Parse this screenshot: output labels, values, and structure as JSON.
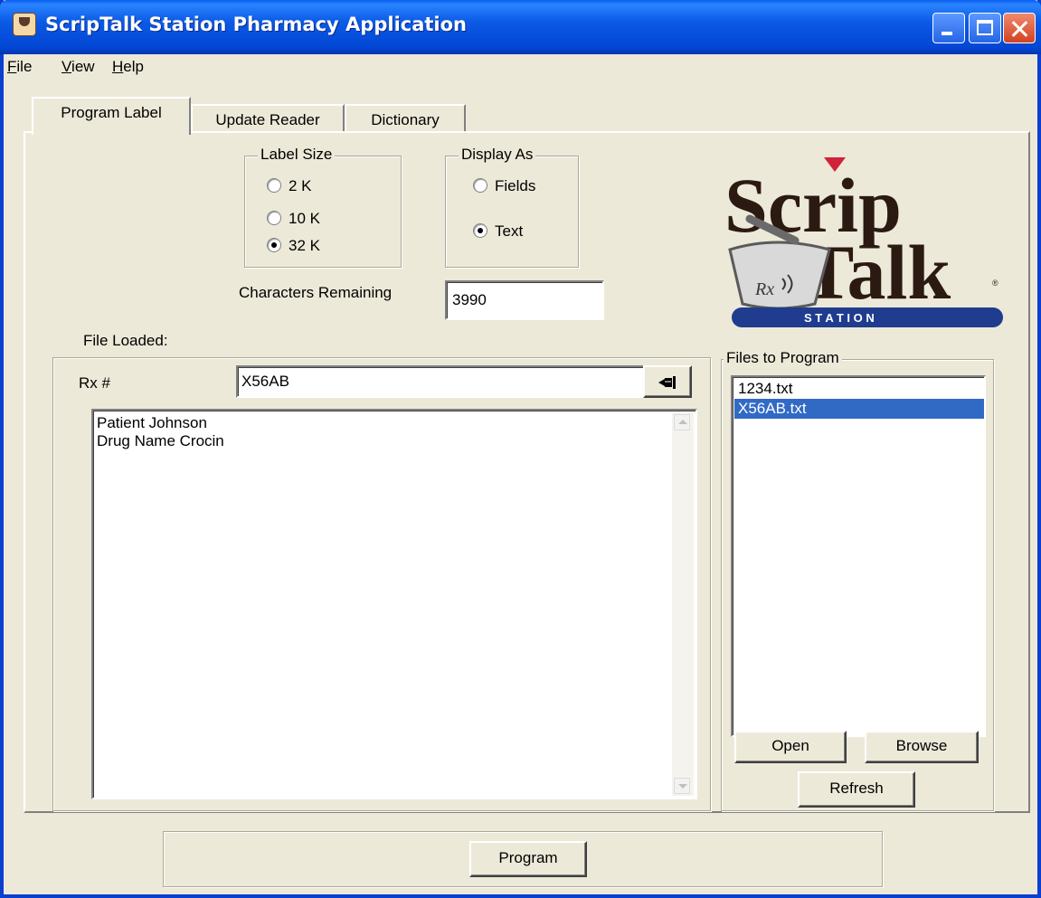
{
  "window": {
    "title": "ScripTalk Station Pharmacy Application"
  },
  "menu": [
    {
      "label": "File",
      "accel": "F",
      "rest": "ile"
    },
    {
      "label": "View",
      "accel": "V",
      "rest": "iew"
    },
    {
      "label": "Help",
      "accel": "H",
      "rest": "elp"
    }
  ],
  "tabs": [
    "Program Label",
    "Update Reader",
    "Dictionary"
  ],
  "label_size": {
    "legend": "Label Size",
    "options": [
      "2 K",
      "10 K",
      "32 K"
    ],
    "selected": "32 K"
  },
  "display_as": {
    "legend": "Display As",
    "options": [
      "Fields",
      "Text"
    ],
    "selected": "Text"
  },
  "chars_remaining": {
    "label": "Characters Remaining",
    "value": "3990"
  },
  "file_loaded_label": "File Loaded:",
  "rx": {
    "label": "Rx #",
    "value": "X56AB"
  },
  "label_text": [
    "Patient Johnson",
    "Drug Name Crocin"
  ],
  "files": {
    "legend": "Files to Program",
    "items": [
      "1234.txt",
      "X56AB.txt"
    ],
    "selected": "X56AB.txt",
    "open": "Open",
    "browse": "Browse",
    "refresh": "Refresh"
  },
  "program_button": "Program",
  "logo": {
    "line1": "Scrip",
    "line2": "Talk",
    "band": "S T A T I O N",
    "mark": "Rx",
    "reg": "®"
  },
  "colors": {
    "title_bar": "#0a5ef0",
    "selection": "#316ac5",
    "logo_band": "#1f3c8f",
    "logo_accent": "#d1223a"
  }
}
